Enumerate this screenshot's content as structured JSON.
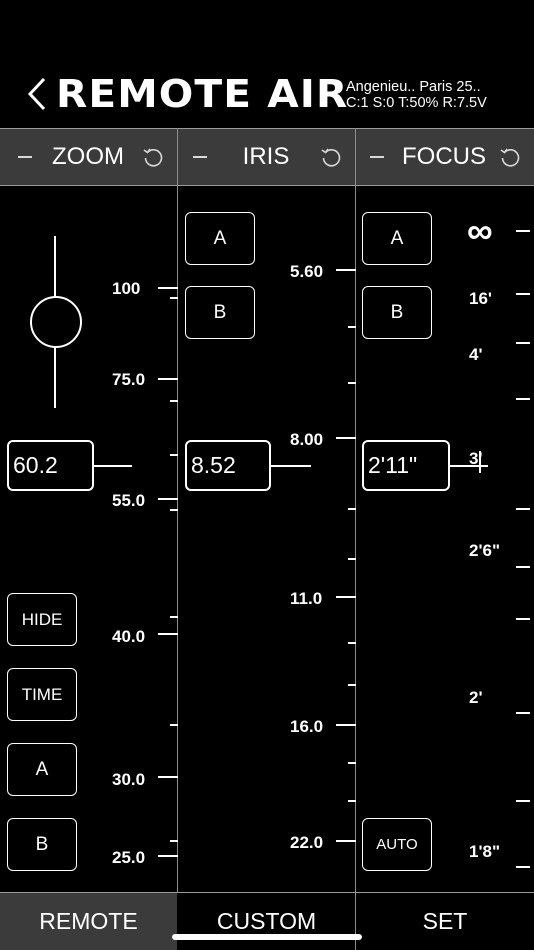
{
  "header": {
    "title": "REMOTE AIR",
    "status_line_1": "Angenieu.. Paris 25..",
    "status_line_2": "C:1 S:0 T:50% R:7.5V"
  },
  "columns": {
    "zoom": {
      "label": "ZOOM",
      "value": "60.2",
      "scale_labels": [
        "100",
        "75.0",
        "55.0",
        "40.0",
        "30.0",
        "25.0"
      ],
      "buttons": [
        "HIDE",
        "TIME",
        "A",
        "B"
      ]
    },
    "iris": {
      "label": "IRIS",
      "value": "8.52",
      "scale_labels": [
        "5.60",
        "8.00",
        "11.0",
        "16.0",
        "22.0"
      ],
      "buttons": [
        "A",
        "B"
      ]
    },
    "focus": {
      "label": "FOCUS",
      "value": "2'11\"",
      "scale_labels": [
        "∞",
        "16'",
        "4'",
        "3'",
        "2'6\"",
        "2'",
        "1'8\""
      ],
      "buttons": [
        "A",
        "B",
        "AUTO"
      ]
    }
  },
  "tabs": [
    "REMOTE",
    "CUSTOM",
    "SET"
  ],
  "selected_tab": "REMOTE",
  "colors": {
    "background": "#000000",
    "header_bar": "#3b3b3b",
    "foreground": "#ffffff"
  },
  "icons": [
    "back-chevron-icon",
    "minus-icon",
    "reset-icon"
  ]
}
